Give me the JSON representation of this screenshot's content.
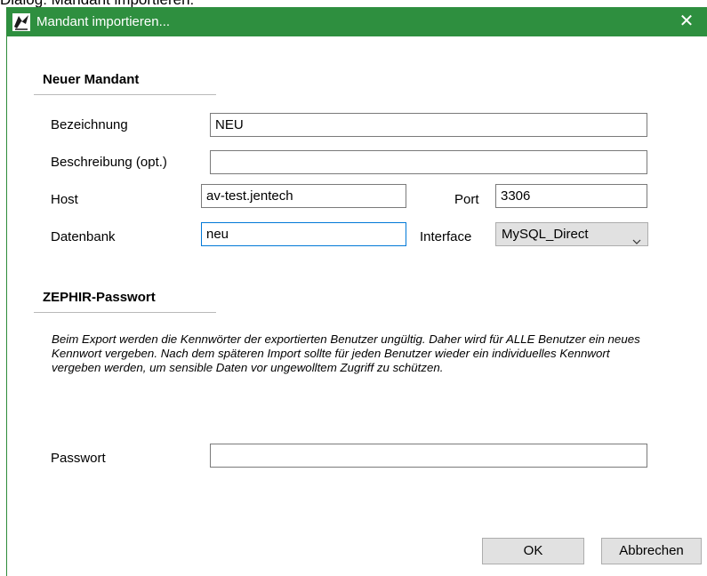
{
  "caption": "Dialog: Mandant importieren:",
  "window": {
    "title": "Mandant importieren...",
    "close_glyph": "✕",
    "titlebar_color": "#2e8f3f",
    "app_icon": "zephir-app-icon"
  },
  "section_new_client": {
    "heading": "Neuer Mandant",
    "bezeichnung_label": "Bezeichnung",
    "bezeichnung_value": "NEU",
    "beschreibung_label": "Beschreibung (opt.)",
    "beschreibung_value": "",
    "host_label": "Host",
    "host_value": "av-test.jentech",
    "port_label": "Port",
    "port_value": "3306",
    "datenbank_label": "Datenbank",
    "datenbank_value": "neu",
    "interface_label": "Interface",
    "interface_value": "MySQL_Direct"
  },
  "section_password": {
    "heading": "ZEPHIR-Passwort",
    "info_text": "Beim Export werden die Kennwörter der exportierten Benutzer ungültig. Daher wird für ALLE Benutzer ein neues Kennwort vergeben. Nach dem späteren Import sollte für jeden Benutzer wieder ein individuelles Kennwort vergeben werden, um sensible Daten vor ungewolltem Zugriff zu schützen.",
    "passwort_label": "Passwort",
    "passwort_value": ""
  },
  "buttons": {
    "ok": "OK",
    "cancel": "Abbrechen"
  }
}
